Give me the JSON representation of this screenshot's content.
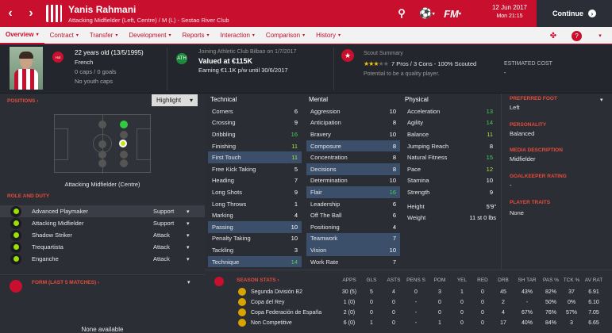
{
  "header": {
    "name": "Yanis Rahmani",
    "subtitle": "Attacking Midfielder (Left, Centre) / M (L) - Sestao River Club",
    "date": "12 Jun 2017",
    "day_time": "Mon 21:15",
    "continue_label": "Continue",
    "fm_logo": "FM"
  },
  "tabs": [
    {
      "label": "Overview",
      "chevron": "▾"
    },
    {
      "label": "Contract",
      "chevron": "▾"
    },
    {
      "label": "Transfer",
      "chevron": "▾"
    },
    {
      "label": "Development",
      "chevron": "▾"
    },
    {
      "label": "Reports",
      "chevron": "▾"
    },
    {
      "label": "Interaction",
      "chevron": "▾"
    },
    {
      "label": "Comparison",
      "chevron": "▾"
    },
    {
      "label": "History",
      "chevron": "▾"
    }
  ],
  "summary": {
    "age_line": "22 years old (13/5/1995)",
    "nationality": "French",
    "caps": "0 caps / 0 goals",
    "youth": "No youth caps",
    "joining": "Joining Athletic Club Bilbao on 1/7/2017",
    "value": "Valued at €115K",
    "earning": "Earning €1.1K p/w until 30/6/2017",
    "scout_title": "Scout Summary",
    "scout_line": "7 Pros / 3 Cons - 100% Scouted",
    "potential": "Potential to be a quality player.",
    "estimated_cost_label": "ESTIMATED COST",
    "estimated_cost_value": "-",
    "hol_badge": "Hol",
    "club_badge": "ATH",
    "stars_on": "★★★",
    "stars_off": "★★"
  },
  "positions": {
    "title": "POSITIONS ›",
    "highlight": "Highlight",
    "caption": "Attacking Midfielder (Centre)"
  },
  "role_duty": {
    "title": "ROLE AND DUTY",
    "roles": [
      {
        "name": "Advanced Playmaker",
        "duty": "Support"
      },
      {
        "name": "Attacking Midfielder",
        "duty": "Support"
      },
      {
        "name": "Shadow Striker",
        "duty": "Attack"
      },
      {
        "name": "Trequartista",
        "duty": "Attack"
      },
      {
        "name": "Enganche",
        "duty": "Attack"
      }
    ]
  },
  "form": {
    "title": "FORM (LAST 5 MATCHES) ›",
    "empty": "None available"
  },
  "technical": {
    "title": "Technical",
    "items": [
      [
        "Corners",
        "6"
      ],
      [
        "Crossing",
        "9"
      ],
      [
        "Dribbling",
        "16"
      ],
      [
        "Finishing",
        "11"
      ],
      [
        "First Touch",
        "11"
      ],
      [
        "Free Kick Taking",
        "5"
      ],
      [
        "Heading",
        "7"
      ],
      [
        "Long Shots",
        "9"
      ],
      [
        "Long Throws",
        "1"
      ],
      [
        "Marking",
        "4"
      ],
      [
        "Passing",
        "10"
      ],
      [
        "Penalty Taking",
        "10"
      ],
      [
        "Tackling",
        "3"
      ],
      [
        "Technique",
        "14"
      ]
    ]
  },
  "mental": {
    "title": "Mental",
    "items": [
      [
        "Aggression",
        "10"
      ],
      [
        "Anticipation",
        "8"
      ],
      [
        "Bravery",
        "10"
      ],
      [
        "Composure",
        "8"
      ],
      [
        "Concentration",
        "8"
      ],
      [
        "Decisions",
        "8"
      ],
      [
        "Determination",
        "10"
      ],
      [
        "Flair",
        "16"
      ],
      [
        "Leadership",
        "6"
      ],
      [
        "Off The Ball",
        "6"
      ],
      [
        "Positioning",
        "4"
      ],
      [
        "Teamwork",
        "7"
      ],
      [
        "Vision",
        "10"
      ],
      [
        "Work Rate",
        "7"
      ]
    ]
  },
  "physical": {
    "title": "Physical",
    "items": [
      [
        "Acceleration",
        "13"
      ],
      [
        "Agility",
        "14"
      ],
      [
        "Balance",
        "11"
      ],
      [
        "Jumping Reach",
        "8"
      ],
      [
        "Natural Fitness",
        "15"
      ],
      [
        "Pace",
        "12"
      ],
      [
        "Stamina",
        "10"
      ],
      [
        "Strength",
        "9"
      ]
    ],
    "height_label": "Height",
    "height": "5'9\"",
    "weight_label": "Weight",
    "weight": "11 st 0 lbs"
  },
  "profile": {
    "foot_label": "PREFERRED FOOT",
    "foot": "Left",
    "personality_label": "PERSONALITY",
    "personality": "Balanced",
    "media_label": "MEDIA DESCRIPTION",
    "media": "Midfielder",
    "gk_label": "GOALKEEPER RATING",
    "gk": "-",
    "traits_label": "PLAYER TRAITS",
    "traits": "None"
  },
  "season": {
    "title": "SEASON STATS ›",
    "headers": [
      "APPS",
      "GLS",
      "ASTS",
      "PENS S",
      "POM",
      "YEL",
      "RED",
      "DRB",
      "SH TAR",
      "PAS %",
      "TCK %",
      "AV RAT"
    ],
    "rows": [
      {
        "comp": "Segunda División B2",
        "vals": [
          "30 (5)",
          "5",
          "4",
          "0",
          "3",
          "1",
          "0",
          "45",
          "43%",
          "82%",
          "37",
          "6.91"
        ]
      },
      {
        "comp": "Copa del Rey",
        "vals": [
          "1 (0)",
          "0",
          "0",
          "-",
          "0",
          "0",
          "0",
          "2",
          "-",
          "50%",
          "0%",
          "6.10"
        ]
      },
      {
        "comp": "Copa Federación de España",
        "vals": [
          "2 (0)",
          "0",
          "0",
          "-",
          "0",
          "0",
          "0",
          "4",
          "67%",
          "76%",
          "57%",
          "7.05"
        ]
      },
      {
        "comp": "Non Competitive",
        "vals": [
          "6 (0)",
          "1",
          "0",
          "-",
          "1",
          "0",
          "0",
          "17",
          "40%",
          "84%",
          "3",
          "6.65"
        ]
      }
    ]
  }
}
